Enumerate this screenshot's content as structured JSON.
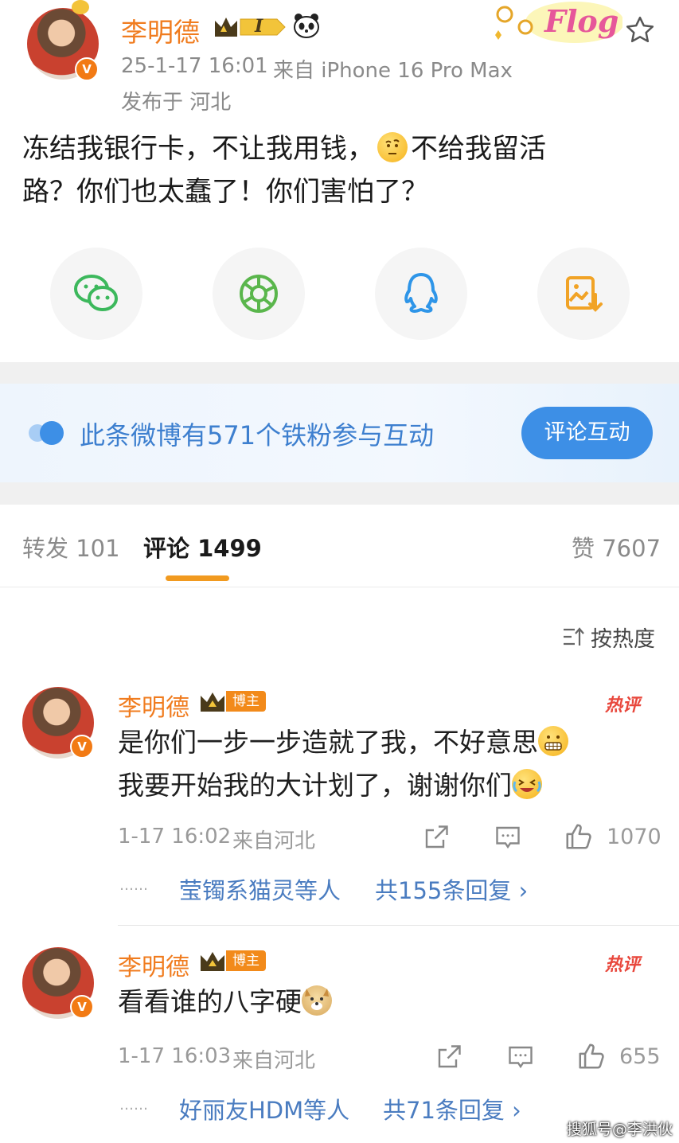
{
  "post": {
    "author": "李明德",
    "level": "I",
    "time": "25-1-17 16:01",
    "source": "来自 iPhone 16 Pro Max",
    "location": "发布于 河北",
    "text_line1": "冻结我银行卡，不让我用钱，",
    "text_line1b": "不给我留活",
    "text_line2": "路？你们也太蠢了！你们害怕了？",
    "flog_label": "Flog"
  },
  "share": {
    "icons": [
      "wechat-icon",
      "moments-icon",
      "qq-icon",
      "save-image-icon"
    ]
  },
  "banner": {
    "text": "此条微博有571个铁粉参与互动",
    "button": "评论互动"
  },
  "tabs": {
    "repost": "转发 101",
    "comments": "评论 1499",
    "likes": "赞 7607"
  },
  "sort": {
    "label": "按热度"
  },
  "comments": [
    {
      "author": "李明德",
      "badge": "博主",
      "hot": "热评",
      "line1": "是你们一步一步造就了我，不好意思",
      "line2": "我要开始我的大计划了，谢谢你们",
      "time": "1-17 16:02",
      "source": "来自河北",
      "likes": "1070",
      "reply_dots": "……",
      "reply_text": "莹镯系猫灵等人",
      "reply_count": "共155条回复 ›"
    },
    {
      "author": "李明德",
      "badge": "博主",
      "hot": "热评",
      "line1": "看看谁的八字硬",
      "time": "1-17 16:03",
      "source": "来自河北",
      "likes": "655",
      "reply_dots": "……",
      "reply_text": "好丽友HDM等人",
      "reply_count": "共71条回复 ›"
    }
  ],
  "watermark": "搜狐号@李洪伙",
  "colors": {
    "accent_orange": "#f07c1f",
    "link_blue": "#4a7cc0",
    "button_blue": "#3d8fe6",
    "hot_red": "#e8473c"
  }
}
